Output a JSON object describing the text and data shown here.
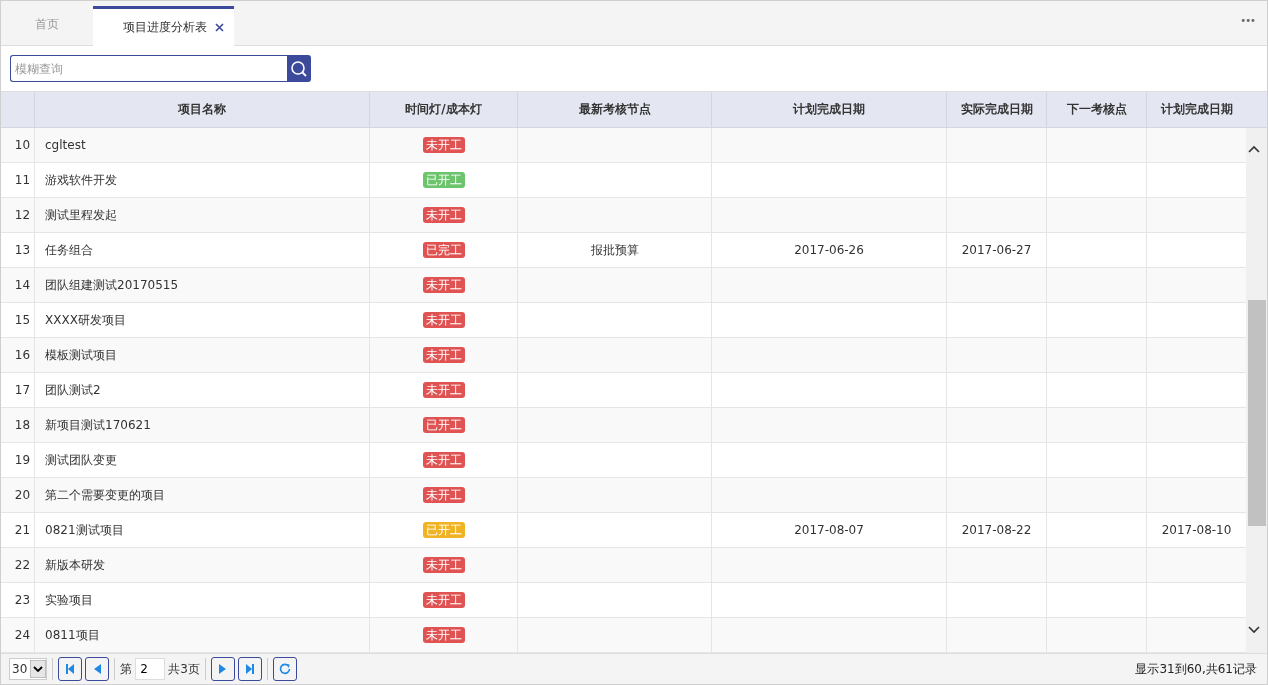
{
  "tabs": [
    {
      "label": "首页",
      "selected": false,
      "closable": false
    },
    {
      "label": "项目进度分析表",
      "selected": true,
      "closable": true
    }
  ],
  "more_menu": "•••",
  "search": {
    "placeholder": "模糊查询"
  },
  "table": {
    "columns": [
      "项目名称",
      "时间灯/成本灯",
      "最新考核节点",
      "计划完成日期",
      "实际完成日期",
      "下一考核点",
      "计划完成日期"
    ],
    "rows": [
      {
        "index": "10",
        "name": "cgltest",
        "status": "未开工",
        "color": "#e05353",
        "node": "",
        "planned": "",
        "actual": "",
        "next": "",
        "planned_2": ""
      },
      {
        "index": "11",
        "name": "游戏软件开发",
        "status": "已开工",
        "color": "#6cc46c",
        "node": "",
        "planned": "",
        "actual": "",
        "next": "",
        "planned_2": ""
      },
      {
        "index": "12",
        "name": "测试里程发起",
        "status": "未开工",
        "color": "#e05353",
        "node": "",
        "planned": "",
        "actual": "",
        "next": "",
        "planned_2": ""
      },
      {
        "index": "13",
        "name": "任务组合",
        "status": "已完工",
        "color": "#e05353",
        "node": "报批预算",
        "planned": "2017-06-26",
        "actual": "2017-06-27",
        "next": "",
        "planned_2": ""
      },
      {
        "index": "14",
        "name": "团队组建测试20170515",
        "status": "未开工",
        "color": "#e05353",
        "node": "",
        "planned": "",
        "actual": "",
        "next": "",
        "planned_2": ""
      },
      {
        "index": "15",
        "name": "XXXX研发项目",
        "status": "未开工",
        "color": "#e05353",
        "node": "",
        "planned": "",
        "actual": "",
        "next": "",
        "planned_2": ""
      },
      {
        "index": "16",
        "name": "模板测试项目",
        "status": "未开工",
        "color": "#e05353",
        "node": "",
        "planned": "",
        "actual": "",
        "next": "",
        "planned_2": ""
      },
      {
        "index": "17",
        "name": "团队测试2",
        "status": "未开工",
        "color": "#e05353",
        "node": "",
        "planned": "",
        "actual": "",
        "next": "",
        "planned_2": ""
      },
      {
        "index": "18",
        "name": "新项目测试170621",
        "status": "已开工",
        "color": "#e05353",
        "node": "",
        "planned": "",
        "actual": "",
        "next": "",
        "planned_2": ""
      },
      {
        "index": "19",
        "name": "测试团队变更",
        "status": "未开工",
        "color": "#e05353",
        "node": "",
        "planned": "",
        "actual": "",
        "next": "",
        "planned_2": ""
      },
      {
        "index": "20",
        "name": "第二个需要变更的项目",
        "status": "未开工",
        "color": "#e05353",
        "node": "",
        "planned": "",
        "actual": "",
        "next": "",
        "planned_2": ""
      },
      {
        "index": "21",
        "name": "0821测试项目",
        "status": "已开工",
        "color": "#f0b323",
        "node": "",
        "planned": "2017-08-07",
        "actual": "2017-08-22",
        "next": "",
        "planned_2": "2017-08-10"
      },
      {
        "index": "22",
        "name": "新版本研发",
        "status": "未开工",
        "color": "#e05353",
        "node": "",
        "planned": "",
        "actual": "",
        "next": "",
        "planned_2": ""
      },
      {
        "index": "23",
        "name": "实验项目",
        "status": "未开工",
        "color": "#e05353",
        "node": "",
        "planned": "",
        "actual": "",
        "next": "",
        "planned_2": ""
      },
      {
        "index": "24",
        "name": "0811项目",
        "status": "未开工",
        "color": "#e05353",
        "node": "",
        "planned": "",
        "actual": "",
        "next": "",
        "planned_2": ""
      }
    ]
  },
  "pager": {
    "page_size": "30",
    "page_label": "第",
    "page": "2",
    "total_pages": "共3页",
    "summary": "显示31到60,共61记录"
  }
}
